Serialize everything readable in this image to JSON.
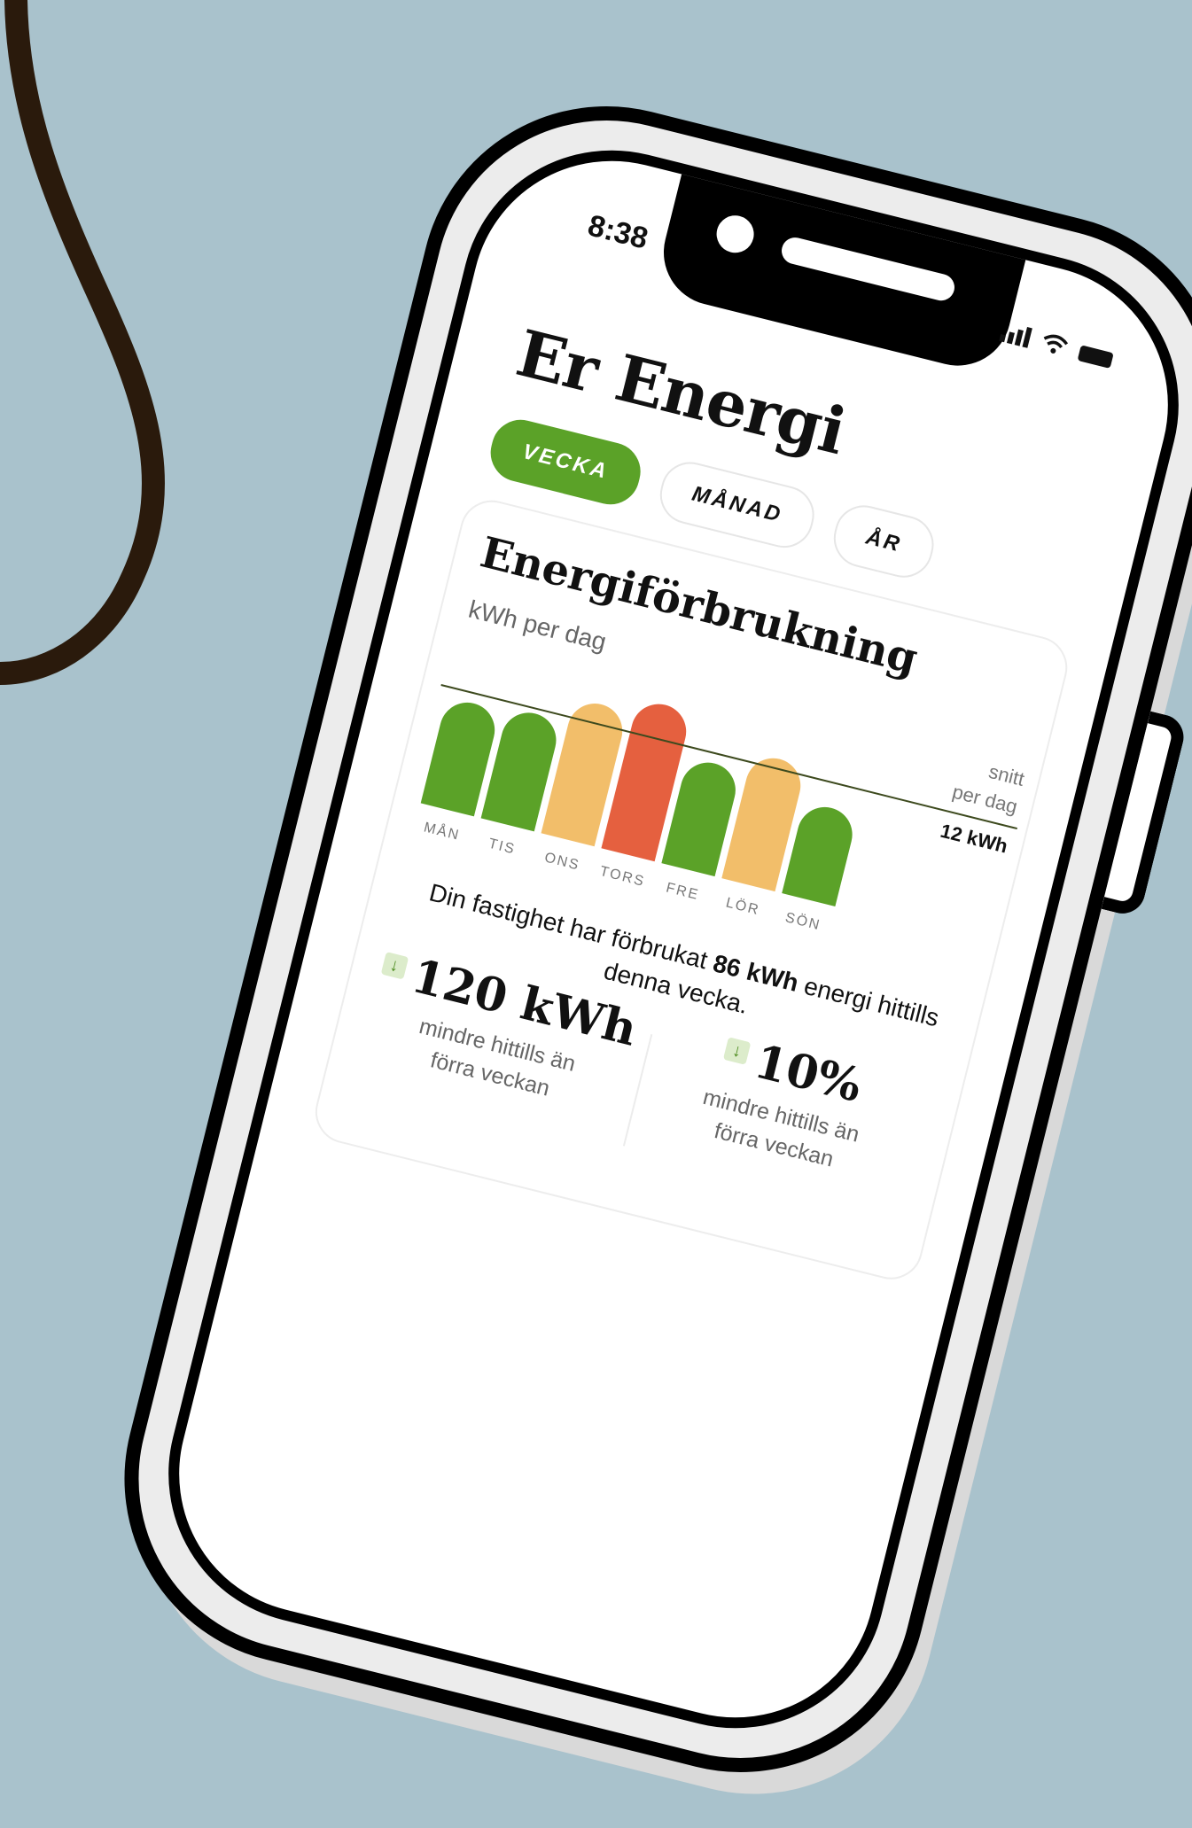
{
  "status_bar": {
    "time": "8:38"
  },
  "header": {
    "title": "Er Energi"
  },
  "tabs": [
    {
      "label": "VECKA",
      "active": true
    },
    {
      "label": "MÅNAD",
      "active": false
    },
    {
      "label": "ÅR",
      "active": false
    }
  ],
  "card": {
    "title": "Energiförbrukning",
    "subtitle": "kWh per dag",
    "summary_prefix": "Din fastighet har förbrukat",
    "summary_value": "86 kWh",
    "summary_suffix": "energi hittills denna vecka.",
    "stats": [
      {
        "value": "120 kWh",
        "text_line1": "mindre hittills än",
        "text_line2": "förra veckan",
        "icon": "arrow-down-icon"
      },
      {
        "value": "10%",
        "text_line1": "mindre hittills än",
        "text_line2": "förra veckan",
        "icon": "arrow-down-icon"
      }
    ]
  },
  "colors": {
    "green": "#5ba228",
    "orange": "#f2be6a",
    "red": "#e5603f",
    "avg_line": "#3d4a1e",
    "background": "#a9c2cc"
  },
  "chart_data": {
    "type": "bar",
    "categories": [
      "MÅN",
      "TIS",
      "ONS",
      "TORS",
      "FRE",
      "LÖR",
      "SÖN"
    ],
    "values": [
      11,
      11.5,
      14,
      15.5,
      11,
      13,
      9.5
    ],
    "bar_colors": [
      "#5ba228",
      "#5ba228",
      "#f2be6a",
      "#e5603f",
      "#5ba228",
      "#f2be6a",
      "#5ba228"
    ],
    "average": 12,
    "average_label_line1": "snitt",
    "average_label_line2": "per dag",
    "average_value_label": "12 kWh",
    "ylim": [
      0,
      16
    ]
  }
}
